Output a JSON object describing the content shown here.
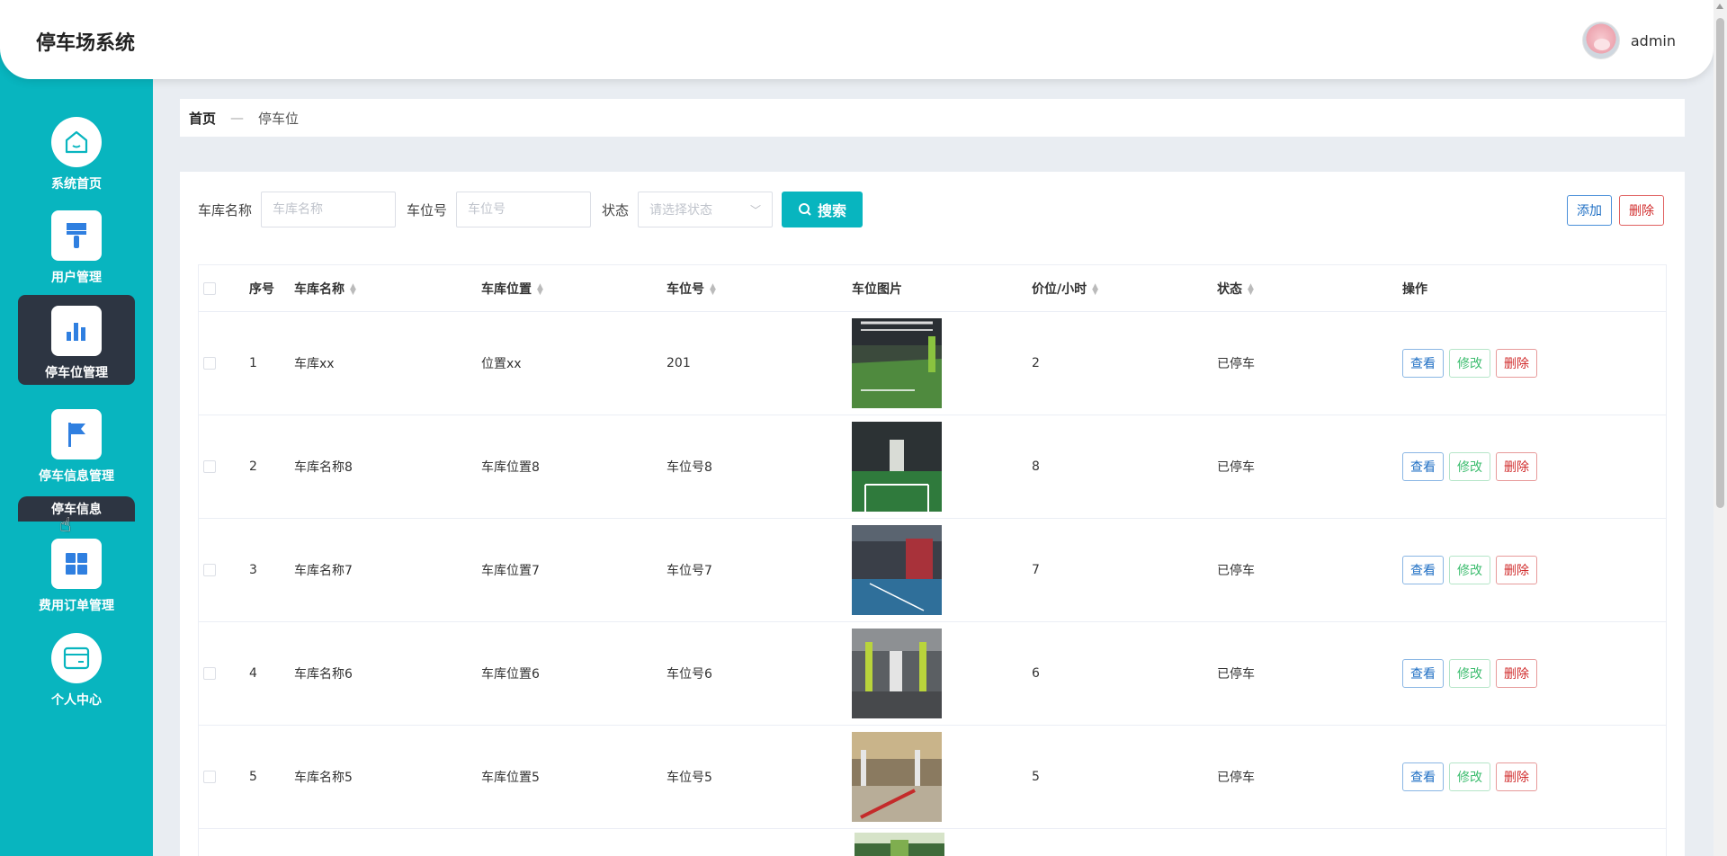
{
  "header": {
    "title": "停车场系统",
    "username": "admin"
  },
  "sidebar": {
    "items": [
      {
        "label": "系统首页"
      },
      {
        "label": "用户管理"
      },
      {
        "label": "停车位管理"
      },
      {
        "label": "停车信息管理"
      },
      {
        "label": "费用订单管理"
      },
      {
        "label": "个人中心"
      }
    ],
    "submenu_label": "停车信息"
  },
  "breadcrumb": {
    "home": "首页",
    "separator": "—",
    "current": "停车位"
  },
  "search": {
    "garage_label": "车库名称",
    "garage_placeholder": "车库名称",
    "spot_label": "车位号",
    "spot_placeholder": "车位号",
    "state_label": "状态",
    "state_placeholder": "请选择状态",
    "search_button": "搜索"
  },
  "toolbar": {
    "add_label": "添加",
    "delete_label": "删除"
  },
  "table": {
    "headers": {
      "index": "序号",
      "garage_name": "车库名称",
      "garage_position": "车库位置",
      "spot_no": "车位号",
      "spot_image": "车位图片",
      "price": "价位/小时",
      "state": "状态",
      "ops": "操作"
    },
    "op_labels": {
      "view": "查看",
      "edit": "修改",
      "delete": "删除"
    },
    "rows": [
      {
        "index": "1",
        "garage_name": "车库xx",
        "garage_position": "位置xx",
        "spot_no": "201",
        "price": "2",
        "state": "已停车"
      },
      {
        "index": "2",
        "garage_name": "车库名称8",
        "garage_position": "车库位置8",
        "spot_no": "车位号8",
        "price": "8",
        "state": "已停车"
      },
      {
        "index": "3",
        "garage_name": "车库名称7",
        "garage_position": "车库位置7",
        "spot_no": "车位号7",
        "price": "7",
        "state": "已停车"
      },
      {
        "index": "4",
        "garage_name": "车库名称6",
        "garage_position": "车库位置6",
        "spot_no": "车位号6",
        "price": "6",
        "state": "已停车"
      },
      {
        "index": "5",
        "garage_name": "车库名称5",
        "garage_position": "车库位置5",
        "spot_no": "车位号5",
        "price": "5",
        "state": "已停车"
      }
    ]
  },
  "colors": {
    "accent": "#08b5bf",
    "sidebar_active": "#2d3542",
    "icon_blue": "#2f7fe0"
  }
}
